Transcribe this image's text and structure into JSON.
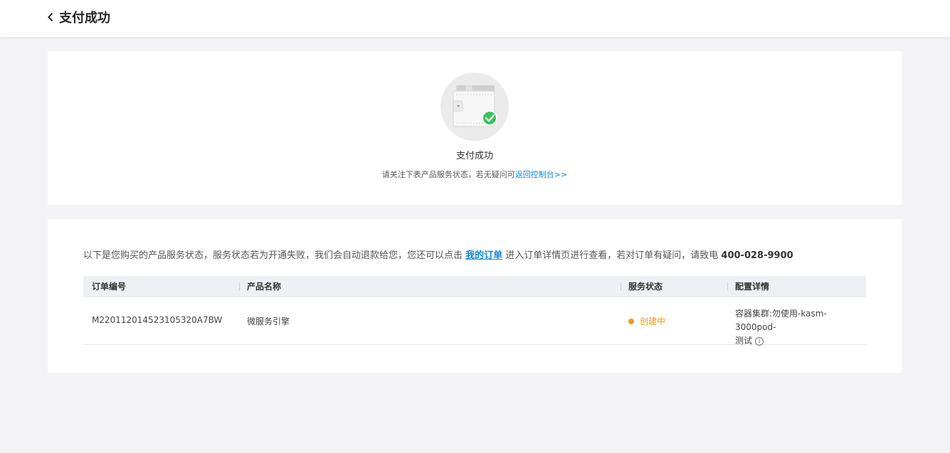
{
  "header": {
    "title": "支付成功"
  },
  "success": {
    "title": "支付成功",
    "sub_text": "请关注下表产品服务状态，若无疑问可",
    "link_text": "返回控制台>>"
  },
  "notice": {
    "text_before": "以下是您购买的产品服务状态，服务状态若为开通失败，我们会自动退款给您，您还可以点击 ",
    "link_text": "我的订单",
    "text_after": " 进入订单详情页进行查看，若对订单有疑问，请致电 ",
    "phone": "400-028-9900"
  },
  "table": {
    "headers": [
      "订单编号",
      "产品名称",
      "服务状态",
      "配置详情"
    ],
    "rows": [
      {
        "order_id": "M220112014523105320A7BW",
        "product": "微服务引擎",
        "status": "创建中",
        "config_line1": "容器集群:勿使用-kasm-3000pod-",
        "config_line2": "测试"
      }
    ]
  },
  "colors": {
    "accent": "#0a8ad8",
    "status_creating": "#f39c12",
    "success_green": "#3ec25d"
  }
}
